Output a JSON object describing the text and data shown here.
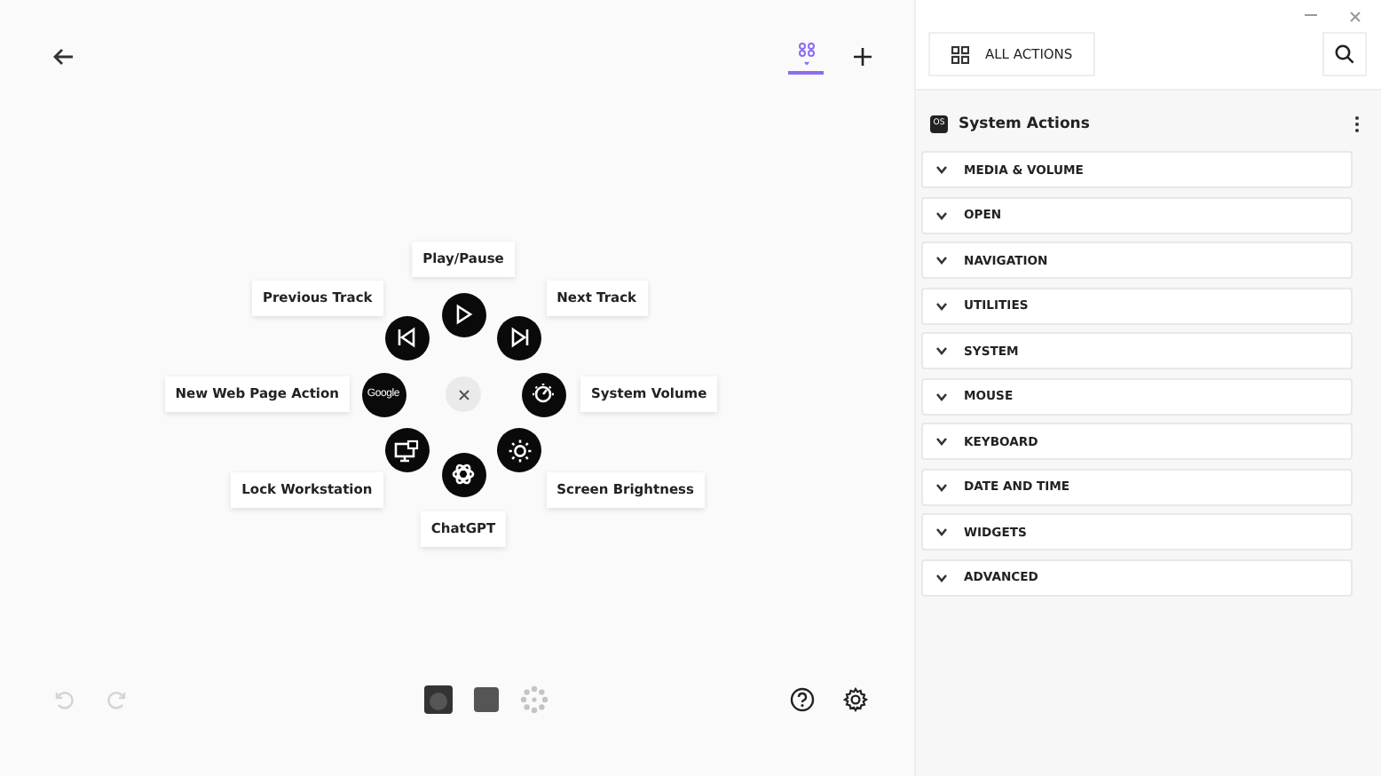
{
  "toolbar": {
    "views": [
      {
        "kind": "grid",
        "selected": true
      }
    ]
  },
  "radial_menu": {
    "actions": [
      {
        "label": "Play/Pause",
        "kind": "play"
      },
      {
        "label": "Previous Track",
        "kind": "previous"
      },
      {
        "label": "Next Track",
        "kind": "next"
      },
      {
        "label": "New Web Page Action",
        "kind": "web",
        "logo_text": "Google"
      },
      {
        "label": "System Volume",
        "kind": "volume"
      },
      {
        "label": "Lock Workstation",
        "kind": "lock"
      },
      {
        "label": "Screen Brightness",
        "kind": "brightness"
      },
      {
        "label": "ChatGPT",
        "kind": "chatgpt"
      }
    ]
  },
  "bottom_bar": {
    "undo": {
      "disabled": true
    },
    "redo": {
      "disabled": true
    },
    "devices": [
      {
        "kind": "knob"
      },
      {
        "kind": "pad"
      },
      {
        "kind": "dots"
      }
    ]
  },
  "actions_panel": {
    "all_actions_button": "ALL ACTIONS",
    "section": {
      "badge": "OS",
      "title": "System Actions"
    },
    "categories": [
      {
        "label": "MEDIA & VOLUME",
        "expanded": false
      },
      {
        "label": "OPEN",
        "expanded": false
      },
      {
        "label": "NAVIGATION",
        "expanded": false
      },
      {
        "label": "UTILITIES",
        "expanded": false
      },
      {
        "label": "SYSTEM",
        "expanded": false
      },
      {
        "label": "MOUSE",
        "expanded": false
      },
      {
        "label": "KEYBOARD",
        "expanded": false
      },
      {
        "label": "DATE AND TIME",
        "expanded": false
      },
      {
        "label": "WIDGETS",
        "expanded": false
      },
      {
        "label": "ADVANCED",
        "expanded": false
      }
    ]
  }
}
